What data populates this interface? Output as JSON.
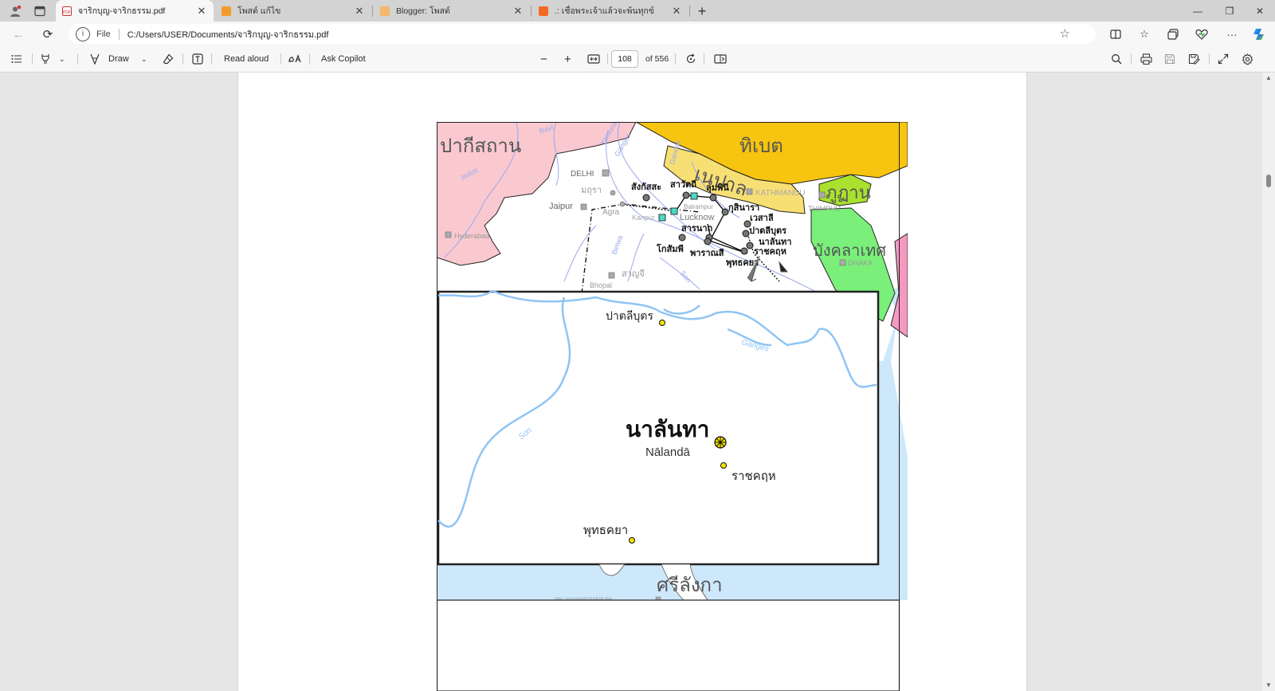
{
  "browser": {
    "tabs": [
      {
        "title": "จาริกบุญ-จาริกธรรม.pdf",
        "favicon": "pdf",
        "active": true
      },
      {
        "title": "โพสต์ แก้ไข",
        "favicon": "blogger",
        "active": false
      },
      {
        "title": "Blogger: โพสต์",
        "favicon": "blogger",
        "active": false
      },
      {
        "title": ".: เชื่อพระเจ้าแล้วจะพ้นทุกข์",
        "favicon": "blogger",
        "active": false
      }
    ],
    "address": {
      "scheme_label": "File",
      "url": "C:/Users/USER/Documents/จาริกบุญ-จาริกธรรม.pdf"
    }
  },
  "pdf_toolbar": {
    "draw_label": "Draw",
    "read_aloud_label": "Read aloud",
    "ask_copilot_label": "Ask Copilot",
    "current_page": "108",
    "page_count_label": "of 556"
  },
  "map": {
    "countries": [
      "ปากีสถาน",
      "ทิเบต",
      "เนปาล",
      "ภูฏาน",
      "บังคลาเทศ",
      "ศรีลังกา"
    ],
    "cities": [
      "DELHI",
      "มถุรา",
      "Jaipur",
      "Agra",
      "Kanpur",
      "Lucknow",
      "Balrampur",
      "KATHMANDU",
      "THIMPHU",
      "Hyderabad",
      "Bhopal",
      "สาญจี",
      "DHAKA",
      "SRI JAYAWARDENEPURA"
    ],
    "sites": [
      "สังกัสสะ",
      "สาวัตถี",
      "ลุมพินี",
      "กุสินารา",
      "เวสาลี",
      "ปาตลีบุตร",
      "สารนาถ",
      "นาลันทา",
      "ราชคฤห",
      "โกสัมพี",
      "พาราณสี",
      "พุทธคยา"
    ],
    "rivers": [
      "Ravi",
      "Indus",
      "Yamuna",
      "Ganges",
      "Gandak",
      "Betwa",
      "Son",
      "Ganges"
    ],
    "inset": {
      "title_th": "นาลันทา",
      "title_en": "Nālandā",
      "places": [
        "ปาตลีบุตร",
        "ราชคฤห",
        "พุทธคยา"
      ],
      "rivers": [
        "Ganges",
        "Son"
      ]
    },
    "colors": {
      "pakistan": "#f9c9cf",
      "tibet": "#f7c40f",
      "nepal": "#f8df74",
      "bhutan": "#a9e12e",
      "bangladesh": "#7af07a",
      "sea": "#cde8fb",
      "river": "#8fc4f5"
    }
  }
}
